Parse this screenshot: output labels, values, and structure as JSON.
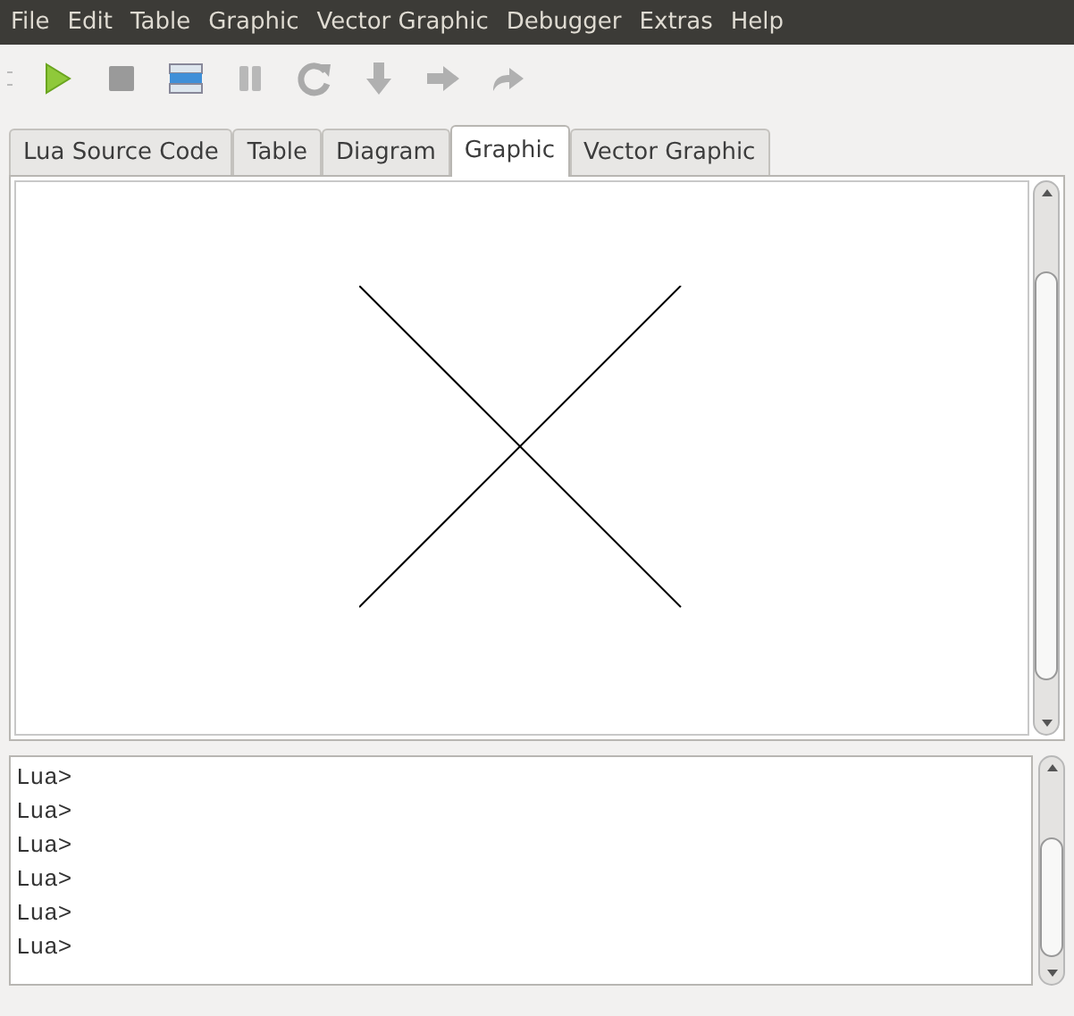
{
  "menu_bar": [
    "File",
    "Edit",
    "Table",
    "Graphic",
    "Vector Graphic",
    "Debugger",
    "Extras",
    "Help"
  ],
  "toolbar": [
    {
      "kind": "play",
      "enabled": true
    },
    {
      "kind": "stop",
      "enabled": false
    },
    {
      "kind": "list",
      "enabled": true
    },
    {
      "kind": "pause",
      "enabled": false
    },
    {
      "kind": "refresh",
      "enabled": false
    },
    {
      "kind": "step-into",
      "enabled": false
    },
    {
      "kind": "step-over",
      "enabled": false
    },
    {
      "kind": "step-out",
      "enabled": false
    }
  ],
  "tabs": [
    {
      "label": "Lua Source Code",
      "selected": false
    },
    {
      "label": "Table",
      "selected": false
    },
    {
      "label": "Diagram",
      "selected": false
    },
    {
      "label": "Graphic",
      "selected": true
    },
    {
      "label": "Vector Graphic",
      "selected": false
    }
  ],
  "console": {
    "lines": [
      "Lua>",
      "Lua>",
      "Lua>",
      "Lua>",
      "Lua>",
      "Lua>"
    ]
  }
}
